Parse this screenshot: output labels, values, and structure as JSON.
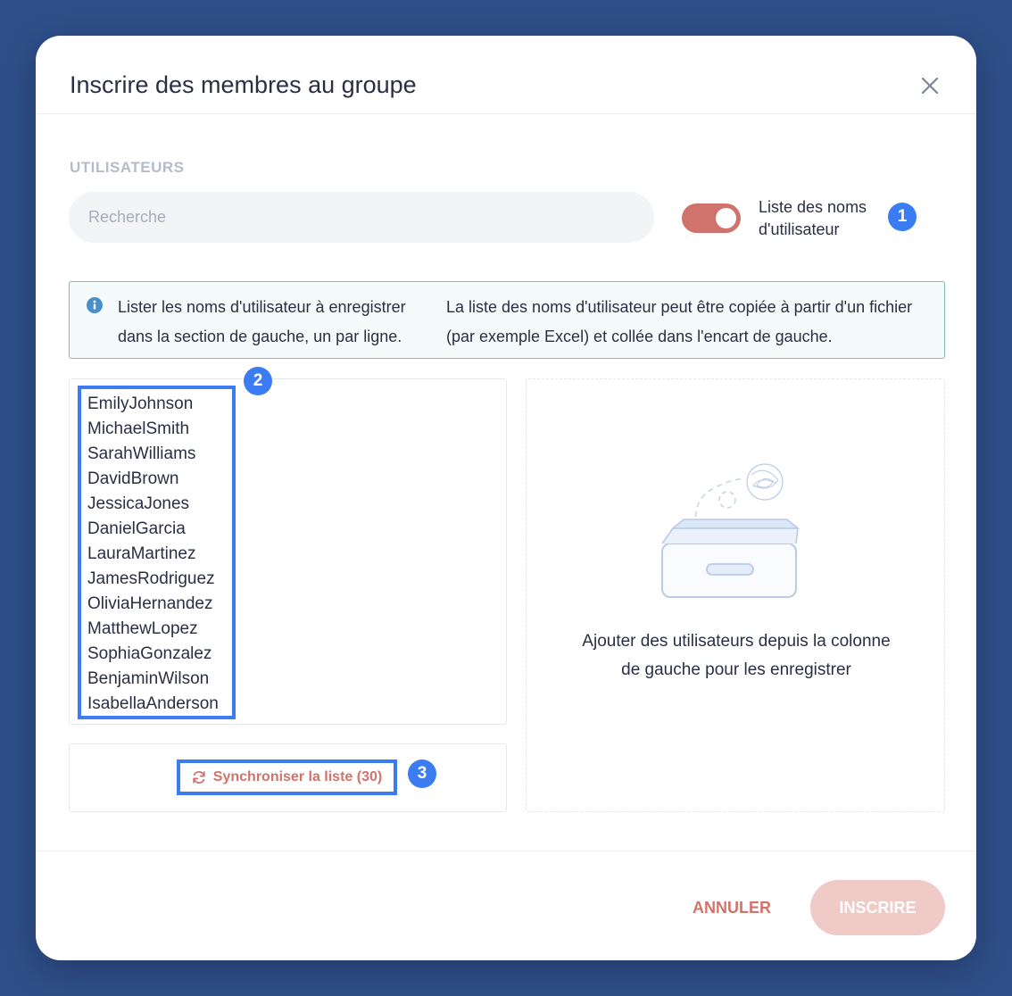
{
  "modal": {
    "title": "Inscrire des membres au groupe"
  },
  "users_section": {
    "label": "UTILISATEURS",
    "search_placeholder": "Recherche",
    "toggle_label": "Liste des noms d'utilisateur",
    "toggle_on": true
  },
  "annotations": [
    "1",
    "2",
    "3"
  ],
  "info": {
    "left_text": "Lister les noms d'utilisateur à enregistrer dans la section de gauche, un par ligne.",
    "right_text": "La liste des noms d'utilisateur peut être copiée à partir d'un fichier (par exemple Excel) et collée dans l'encart de gauche."
  },
  "usernames": [
    "EmilyJohnson",
    "MichaelSmith",
    "SarahWilliams",
    "DavidBrown",
    "JessicaJones",
    "DanielGarcia",
    "LauraMartinez",
    "JamesRodriguez",
    "OliviaHernandez",
    "MatthewLopez",
    "SophiaGonzalez",
    "BenjaminWilson",
    "IsabellaAnderson"
  ],
  "sync": {
    "label": "Synchroniser la liste (30)",
    "icon": "refresh-icon"
  },
  "empty_state": {
    "text": "Ajouter des utilisateurs depuis la colonne de gauche pour les enregistrer"
  },
  "footer": {
    "cancel_label": "ANNULER",
    "submit_label": "INSCRIRE"
  },
  "colors": {
    "background": "#2e4f8a",
    "accent": "#d0736c",
    "annotation_blue": "#3b7cf2",
    "submit_disabled": "#f0cac6",
    "info_border": "#7fbfb6"
  }
}
